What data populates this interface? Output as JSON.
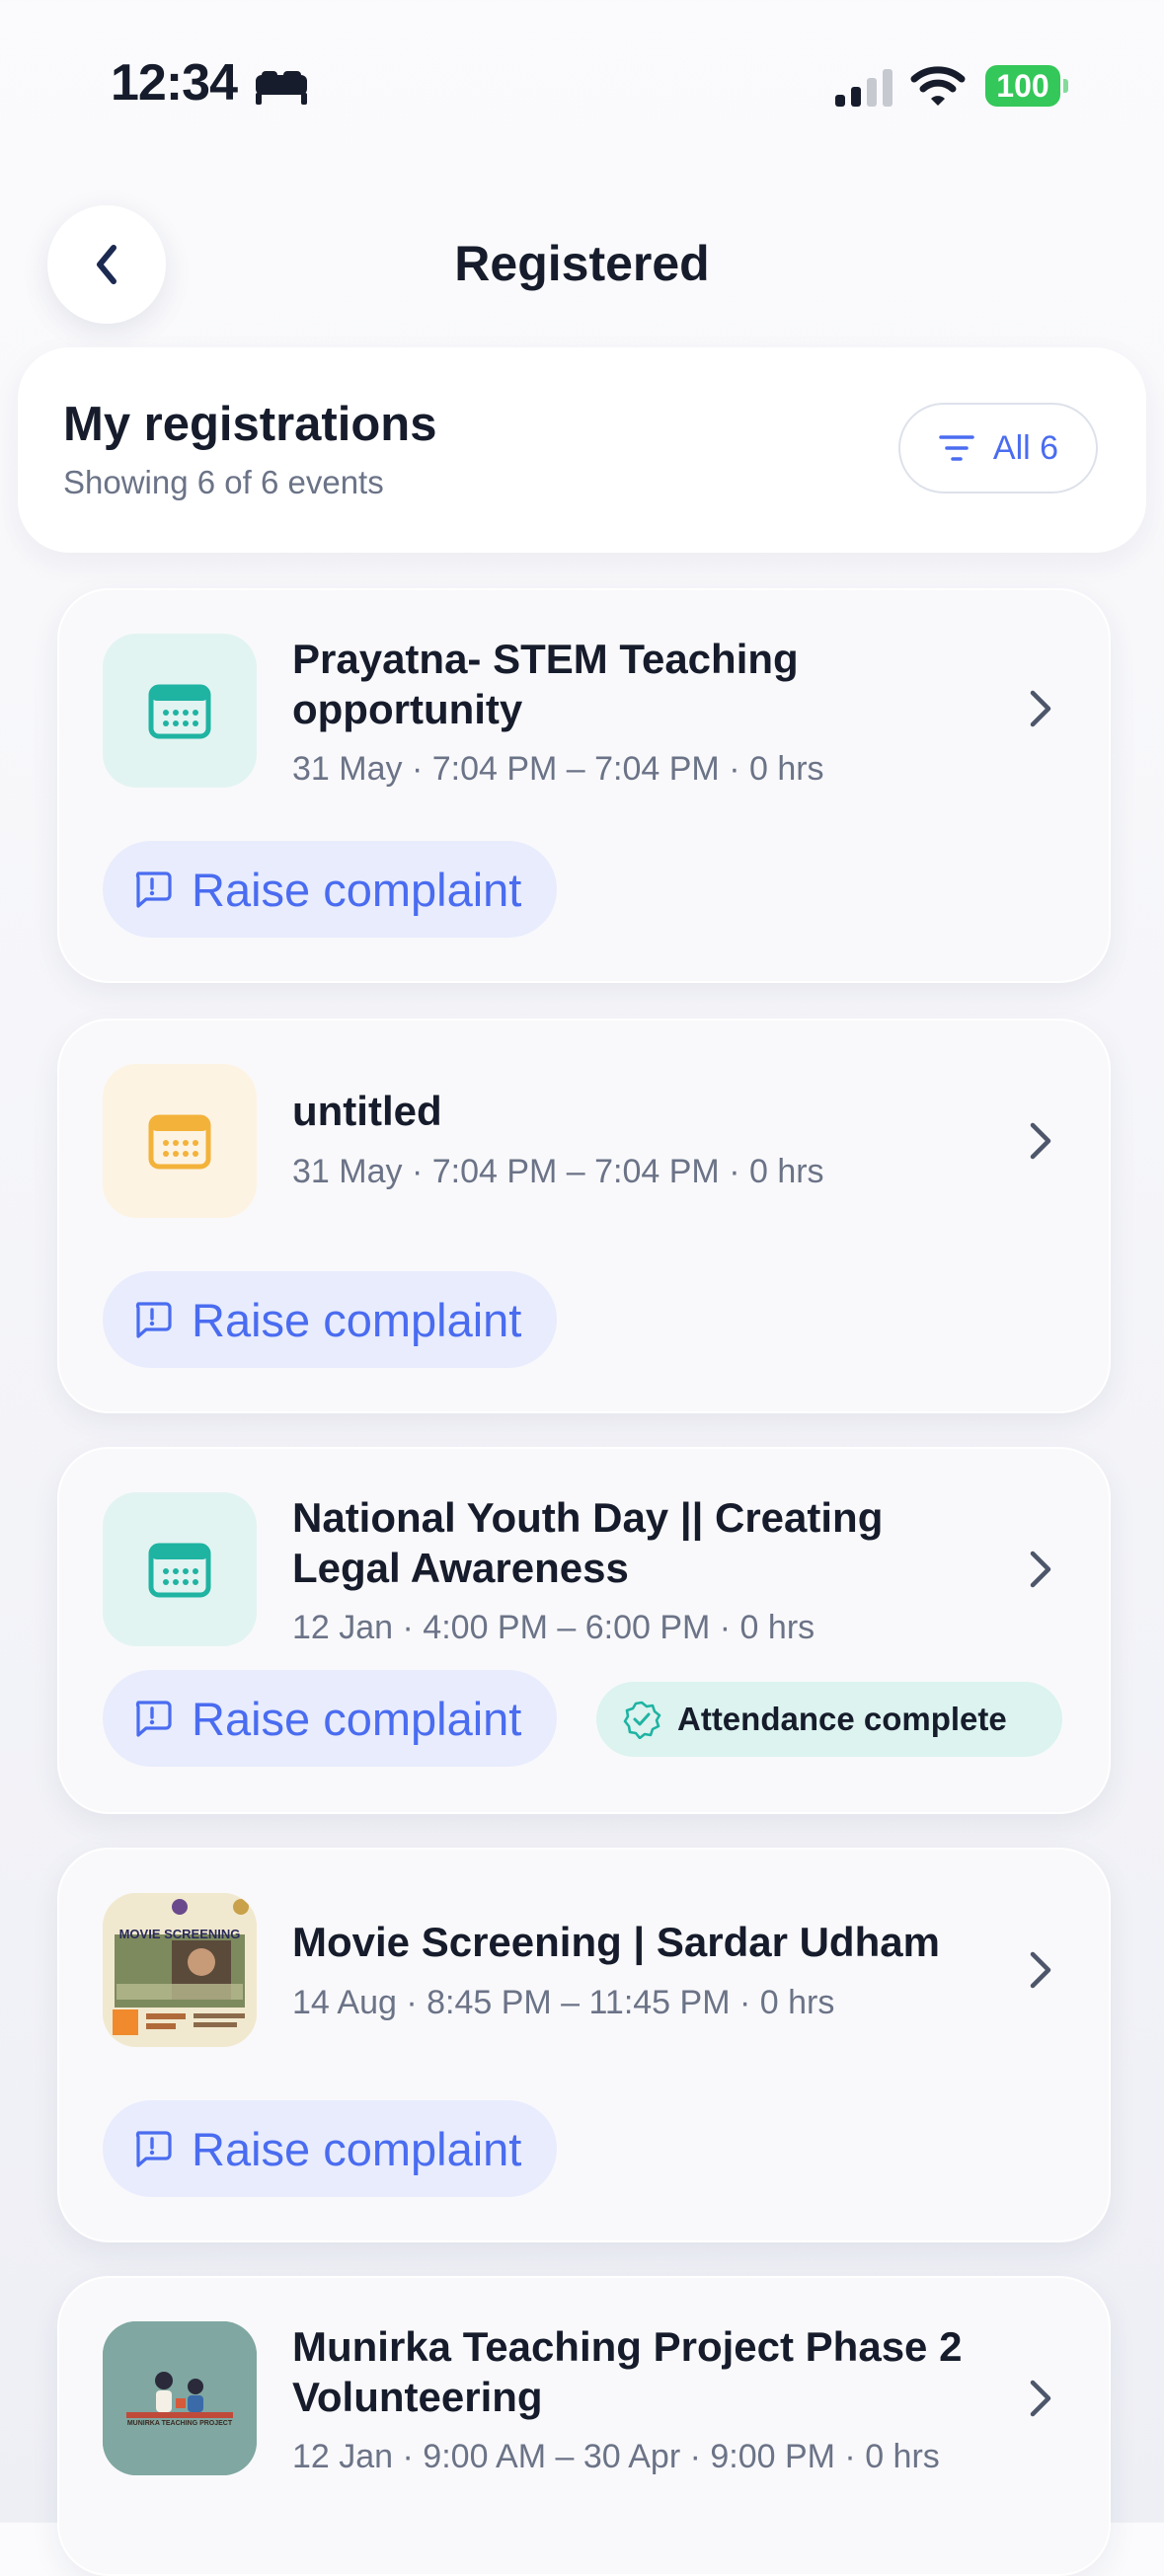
{
  "status_bar": {
    "time": "12:34",
    "battery": "100",
    "focus_icon": "bed-icon"
  },
  "header": {
    "title": "Registered",
    "back_icon": "chevron-left-icon"
  },
  "summary": {
    "heading": "My registrations",
    "subtitle": "Showing 6 of 6 events",
    "filter_label": "All 6",
    "filter_icon": "filter-lines-icon"
  },
  "events": [
    {
      "title": "Prayatna- STEM Teaching opportunity",
      "meta": "31 May · 7:04 PM – 7:04 PM · 0 hrs",
      "complaint_label": "Raise complaint",
      "thumb": "calendar-icon",
      "thumb_color": "#1fb3a2"
    },
    {
      "title": "untitled",
      "meta": "31 May · 7:04 PM – 7:04 PM · 0 hrs",
      "complaint_label": "Raise complaint",
      "thumb": "calendar-icon",
      "thumb_color": "#f3b23a"
    },
    {
      "title": "National Youth Day || Creating Legal Awareness",
      "meta": "12 Jan · 4:00 PM – 6:00 PM · 0 hrs",
      "complaint_label": "Raise complaint",
      "badge": "Attendance complete",
      "thumb": "calendar-icon",
      "thumb_color": "#1fb3a2"
    },
    {
      "title": "Movie Screening | Sardar Udham",
      "meta": "14 Aug · 8:45 PM – 11:45 PM · 0 hrs",
      "complaint_label": "Raise complaint",
      "thumb": "movie-poster-image",
      "poster_text": "MOVIE SCREENING"
    },
    {
      "title": "Munirka Teaching Project Phase 2 Volunteering",
      "meta": "12 Jan · 9:00 AM – 30 Apr · 9:00 PM · 0 hrs",
      "thumb": "teaching-project-image",
      "image_text": "MUNIRKA TEACHING PROJECT"
    }
  ],
  "colors": {
    "accent": "#4a6cf0",
    "teal": "#1fb3a2",
    "amber": "#f3b23a",
    "success_bg": "#dcf3ef"
  }
}
